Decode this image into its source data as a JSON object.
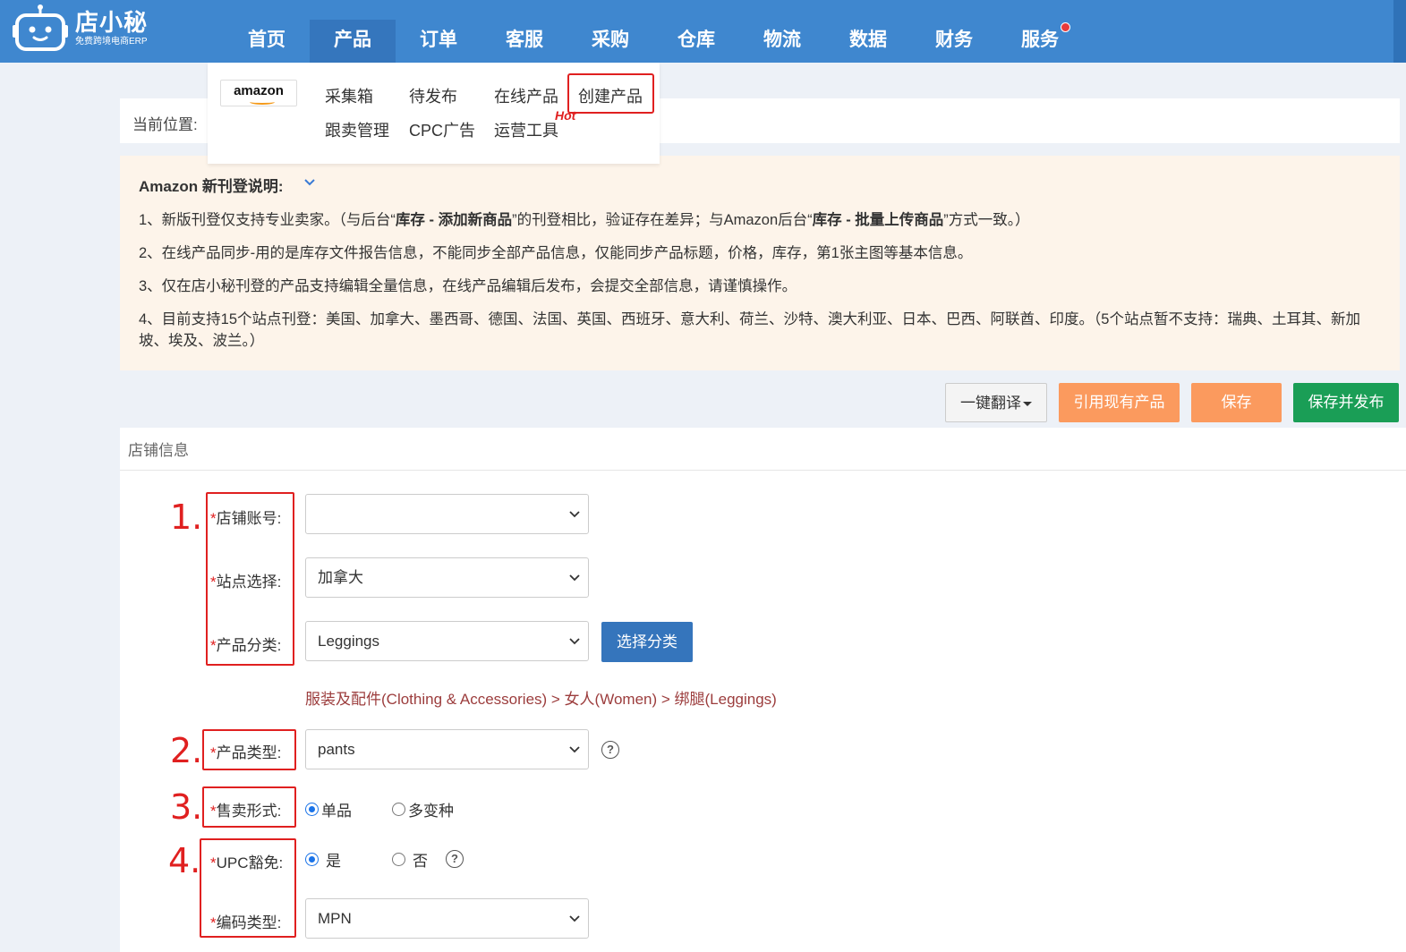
{
  "logo": {
    "name": "店小秘",
    "subtitle": "免费跨境电商ERP"
  },
  "nav": [
    {
      "label": "首页"
    },
    {
      "label": "产品",
      "active": true
    },
    {
      "label": "订单"
    },
    {
      "label": "客服"
    },
    {
      "label": "采购"
    },
    {
      "label": "仓库"
    },
    {
      "label": "物流"
    },
    {
      "label": "数据"
    },
    {
      "label": "财务"
    },
    {
      "label": "服务",
      "has_notification_dot": true
    }
  ],
  "dropdown": {
    "platform_logo": "amazon",
    "items": {
      "collect_box": "采集箱",
      "pending_publish": "待发布",
      "online_products": "在线产品",
      "create_product": "创建产品",
      "follow_sell": "跟卖管理",
      "cpc_ads": "CPC广告",
      "ops_tools": "运营工具"
    },
    "hot_tag": "Hot",
    "highlighted_item": "创建产品"
  },
  "breadcrumb": {
    "label": "当前位置:"
  },
  "notice": {
    "title": "Amazon 新刊登说明:",
    "line1": {
      "a": "1、新版刊登仅支持专业卖家。（与后台“",
      "b": "库存 - 添加新商品",
      "c": "”的刊登相比，验证存在差异；与Amazon后台“",
      "d": "库存 - 批量上传商品",
      "e": "”方式一致。）"
    },
    "line2": "2、在线产品同步-用的是库存文件报告信息，不能同步全部产品信息，仅能同步产品标题，价格，库存，第1张主图等基本信息。",
    "line3": "3、仅在店小秘刊登的产品支持编辑全量信息，在线产品编辑后发布，会提交全部信息，请谨慎操作。",
    "line4": "4、目前支持15个站点刊登：美国、加拿大、墨西哥、德国、法国、英国、西班牙、意大利、荷兰、沙特、澳大利亚、日本、巴西、阿联酋、印度。（5个站点暂不支持：瑞典、土耳其、新加坡、埃及、波兰。）"
  },
  "actions": {
    "translate": "一键翻译",
    "reference": "引用现有产品",
    "save": "保存",
    "save_publish": "保存并发布"
  },
  "panel": {
    "title": "店铺信息"
  },
  "annotations": [
    "1.",
    "2.",
    "3.",
    "4."
  ],
  "form": {
    "required_mark": "*",
    "store_account": {
      "label": "店铺账号:",
      "value": ""
    },
    "site": {
      "label": "站点选择:",
      "value": "加拿大"
    },
    "category": {
      "label": "产品分类:",
      "value": "Leggings",
      "button": "选择分类"
    },
    "category_path": "服装及配件(Clothing & Accessories) > 女人(Women) > 绑腿(Leggings)",
    "product_type": {
      "label": "产品类型:",
      "value": "pants"
    },
    "sell_form": {
      "label": "售卖形式:",
      "options": [
        "单品",
        "多变种"
      ],
      "selected": "单品"
    },
    "upc_exempt": {
      "label": "UPC豁免:",
      "options": [
        "是",
        "否"
      ],
      "selected": "是"
    },
    "code_type": {
      "label": "编码类型:",
      "value": "MPN"
    }
  },
  "colors": {
    "topbar": "#3f87cf",
    "highlight_red": "#e02020",
    "orange_button": "#fb9a5e",
    "green_button": "#1a9e56",
    "blue_button": "#3575bc",
    "notice_bg": "#fdf4ea"
  }
}
